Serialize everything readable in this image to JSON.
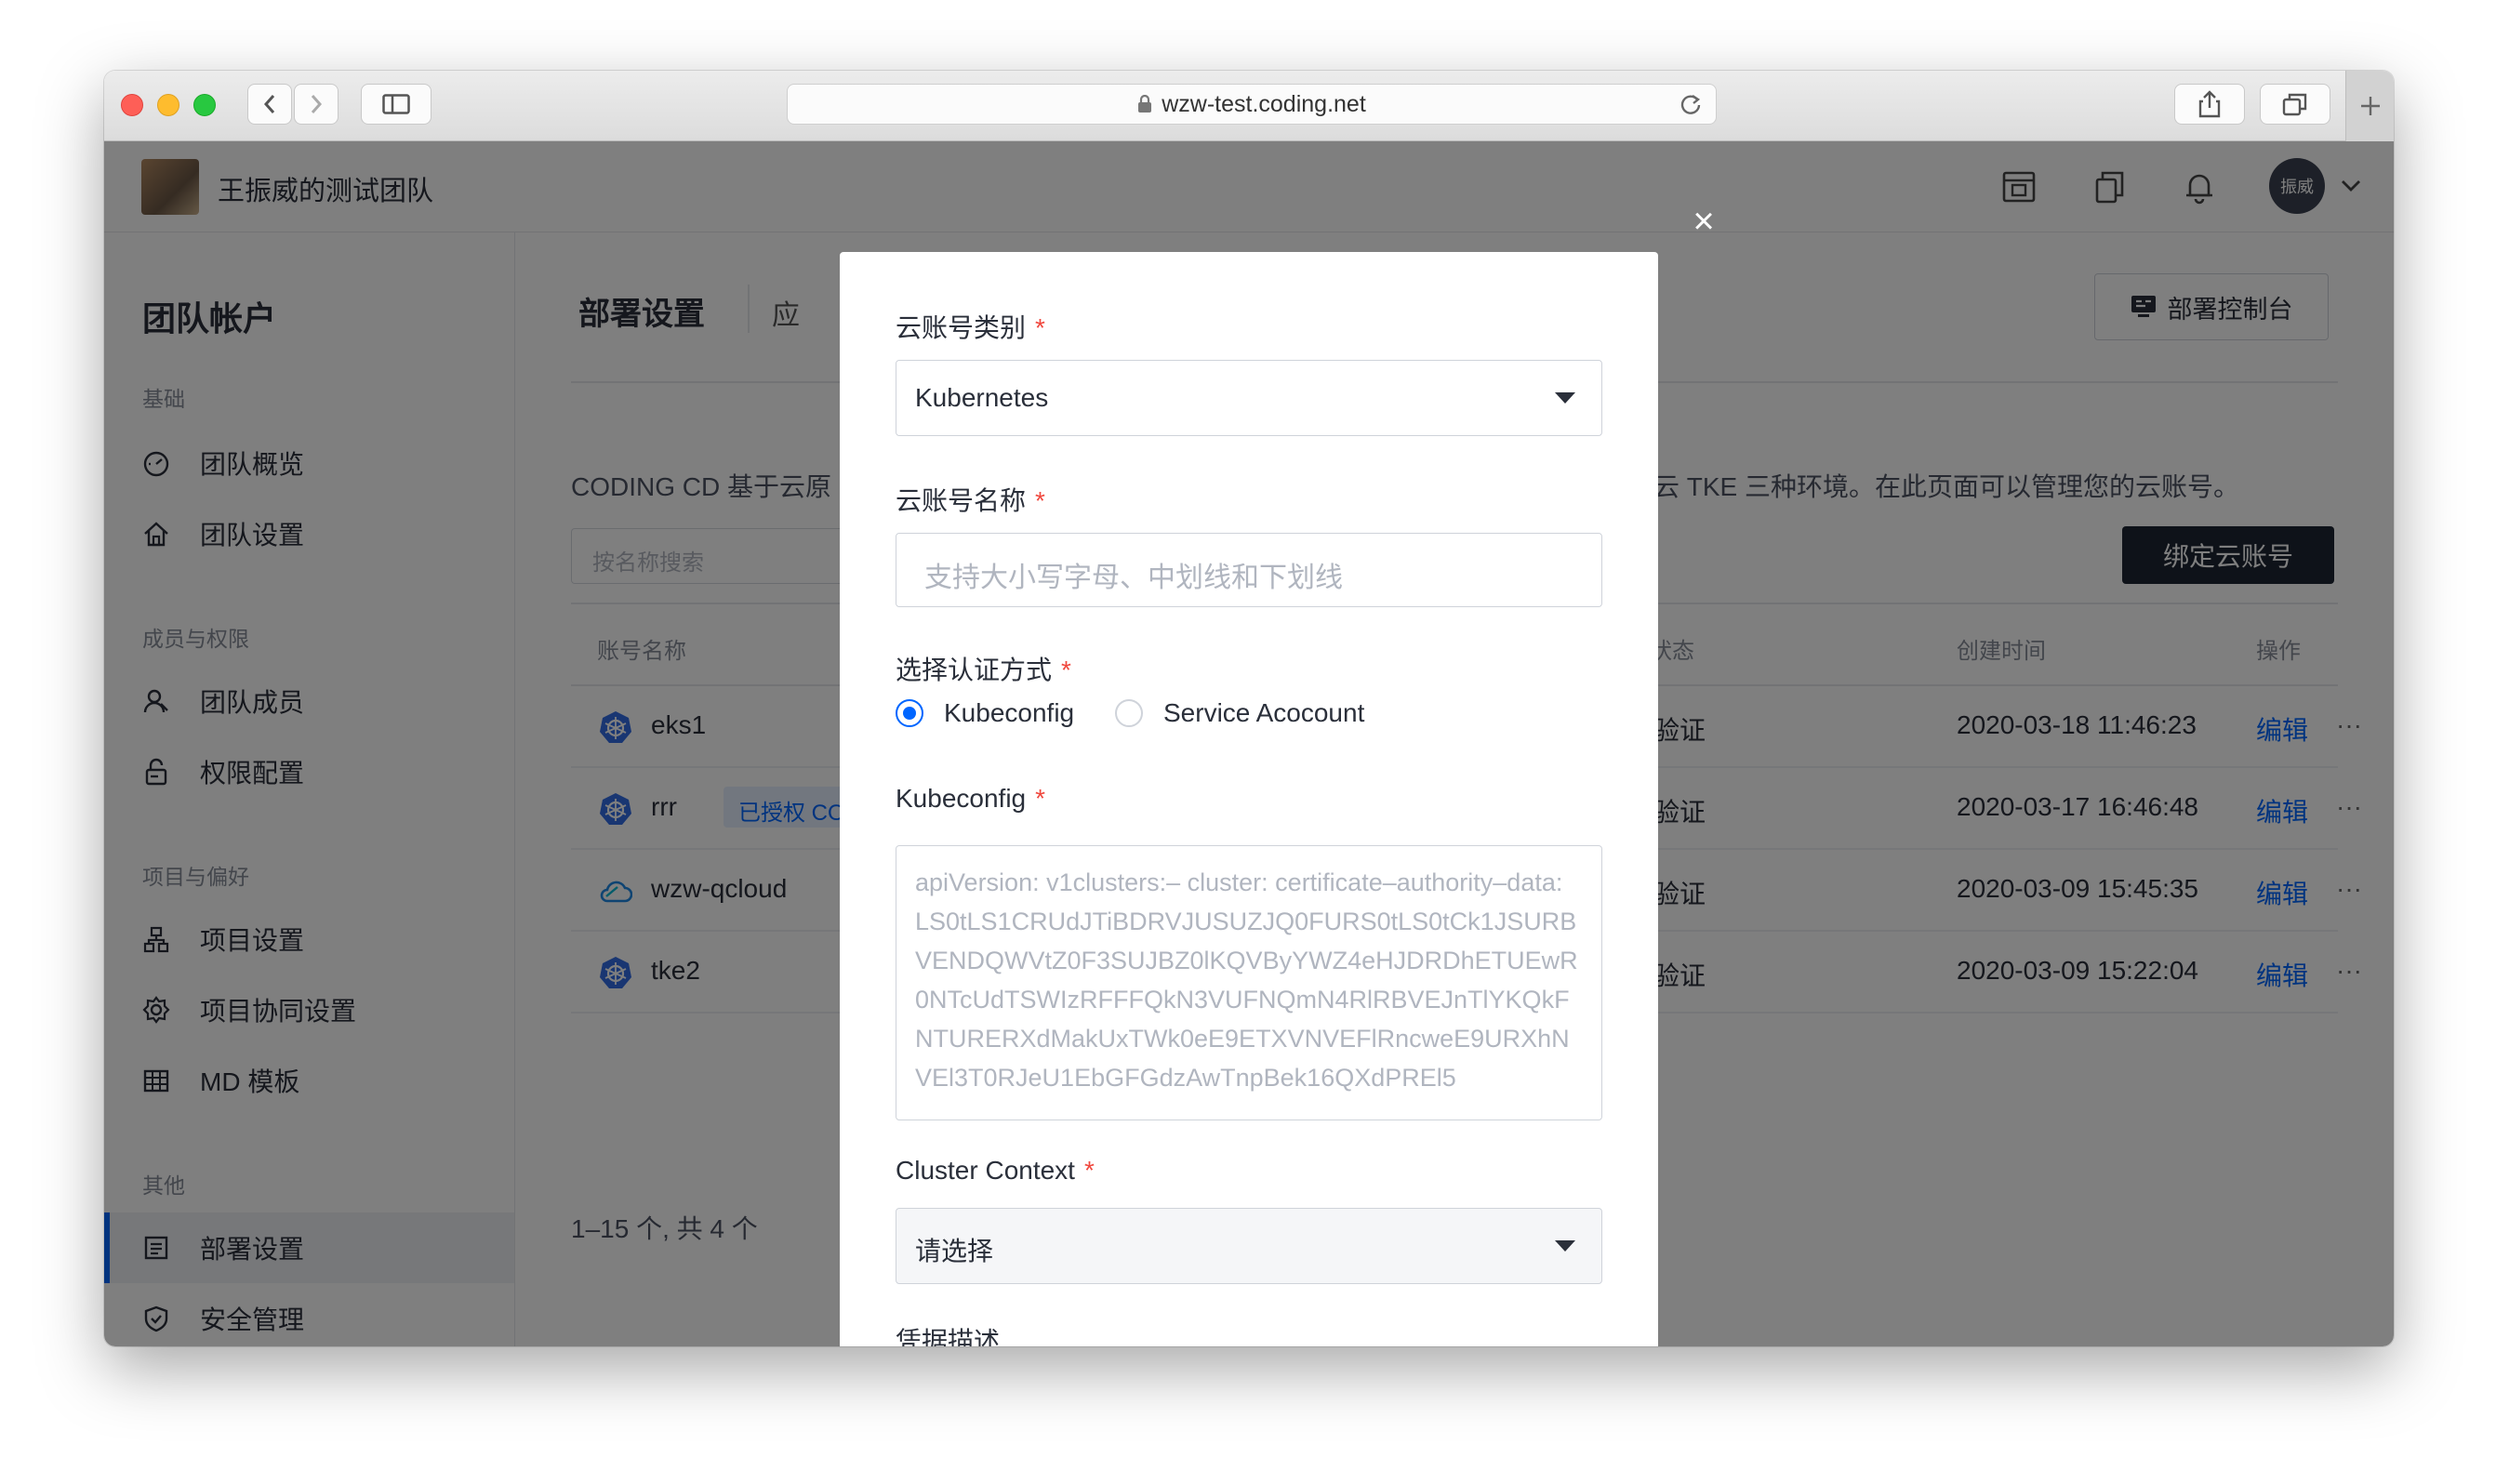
{
  "browser": {
    "url": "wzw-test.coding.net"
  },
  "header": {
    "team_name": "王振威的测试团队",
    "user_avatar_text": "振威"
  },
  "sidebar": {
    "title": "团队帐户",
    "groups": [
      {
        "label": "基础",
        "items": [
          "团队概览",
          "团队设置"
        ]
      },
      {
        "label": "成员与权限",
        "items": [
          "团队成员",
          "权限配置"
        ]
      },
      {
        "label": "项目与偏好",
        "items": [
          "项目设置",
          "项目协同设置",
          "MD 模板"
        ]
      },
      {
        "label": "其他",
        "items": [
          "部署设置",
          "安全管理"
        ]
      }
    ],
    "active_item": "部署设置"
  },
  "main": {
    "title": "部署设置",
    "tab_partial": "应",
    "console_button": "部署控制台",
    "description_left": "CODING CD 基于云原",
    "description_right": "讯云 TKE 三种环境。在此页面可以管理您的云账号。",
    "search_placeholder": "按名称搜索",
    "bind_button": "绑定云账号",
    "columns": {
      "name": "账号名称",
      "status": "号状态",
      "created": "创建时间",
      "ops": "操作"
    },
    "rows": [
      {
        "name": "eks1",
        "badge": "",
        "status": "已验证",
        "created": "2020-03-18 11:46:23",
        "edit": "编辑",
        "more": "···",
        "icon": "kubernetes-icon"
      },
      {
        "name": "rrr",
        "badge": "已授权 COD",
        "status": "已验证",
        "created": "2020-03-17 16:46:48",
        "edit": "编辑",
        "more": "···",
        "icon": "kubernetes-icon"
      },
      {
        "name": "wzw-qcloud",
        "badge": "",
        "status": "已验证",
        "created": "2020-03-09 15:45:35",
        "edit": "编辑",
        "more": "···",
        "icon": "cloud-icon"
      },
      {
        "name": "tke2",
        "badge": "",
        "status": "已验证",
        "created": "2020-03-09 15:22:04",
        "edit": "编辑",
        "more": "···",
        "icon": "kubernetes-icon"
      }
    ],
    "pagination": "1–15 个, 共 4 个"
  },
  "modal": {
    "close": "×",
    "account_type_label": "云账号类别",
    "account_type_value": "Kubernetes",
    "account_name_label": "云账号名称",
    "account_name_placeholder": "支持大小写字母、中划线和下划线",
    "auth_label": "选择认证方式",
    "auth_options": [
      "Kubeconfig",
      "Service Acocount"
    ],
    "auth_selected": "Kubeconfig",
    "kubeconfig_label": "Kubeconfig",
    "kubeconfig_placeholder": "apiVersion: v1clusters:– cluster:    certificate–authority–data: LS0tLS1CRUdJTiBDRVJUSUZJQ0FURS0tLS0tCk1JSURBVENDQWVtZ0F3SUJBZ0lKQVByYWZ4eHJDRDhETUEwR0NTcUdTSWIzRFFFQkN3VUFNQmN4RlRBVEJnTlYKQkFNTURERXdMakUxTWk0eE9ETXVNVEFlRncweE9URXhNVEl3T0RJeU1EbGFGdzAwTnpBek16QXdPREl5",
    "cluster_context_label": "Cluster Context",
    "cluster_context_value": "请选择",
    "credential_desc_label": "凭据描述",
    "required_mark": "*"
  }
}
